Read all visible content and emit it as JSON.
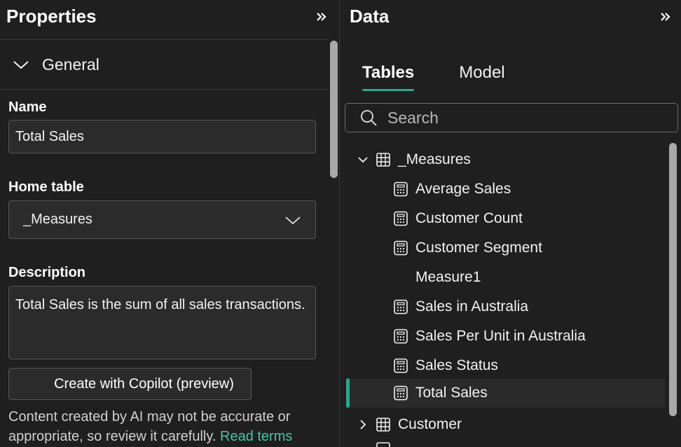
{
  "properties": {
    "title": "Properties",
    "section": "General",
    "name_label": "Name",
    "name_value": "Total Sales",
    "home_table_label": "Home table",
    "home_table_value": "_Measures",
    "description_label": "Description",
    "description_value": "Total Sales is the sum of all sales transactions.",
    "copilot_button": "Create with Copilot (preview)",
    "disclaimer_text": "Content created by AI may not be accurate or appropriate, so review it carefully.",
    "disclaimer_link": "Read terms"
  },
  "data_pane": {
    "title": "Data",
    "tabs": [
      {
        "label": "Tables",
        "active": true
      },
      {
        "label": "Model",
        "active": false
      }
    ],
    "search_placeholder": "Search",
    "tree": {
      "measures_table": "_Measures",
      "measures": [
        {
          "label": "Average Sales",
          "icon": "calculator-icon"
        },
        {
          "label": "Customer Count",
          "icon": "calculator-icon"
        },
        {
          "label": "Customer Segment",
          "icon": "calculator-icon"
        },
        {
          "label": "Measure1",
          "icon": ""
        },
        {
          "label": "Sales in Australia",
          "icon": "calculator-icon"
        },
        {
          "label": "Sales Per Unit in Australia",
          "icon": "calculator-icon"
        },
        {
          "label": "Sales Status",
          "icon": "calculator-icon"
        },
        {
          "label": "Total Sales",
          "icon": "calculator-icon",
          "selected": true
        }
      ],
      "customer_table": "Customer"
    }
  },
  "colors": {
    "accent": "#2fa58d",
    "link": "#4cc2a8",
    "background": "#1f1f1f"
  }
}
